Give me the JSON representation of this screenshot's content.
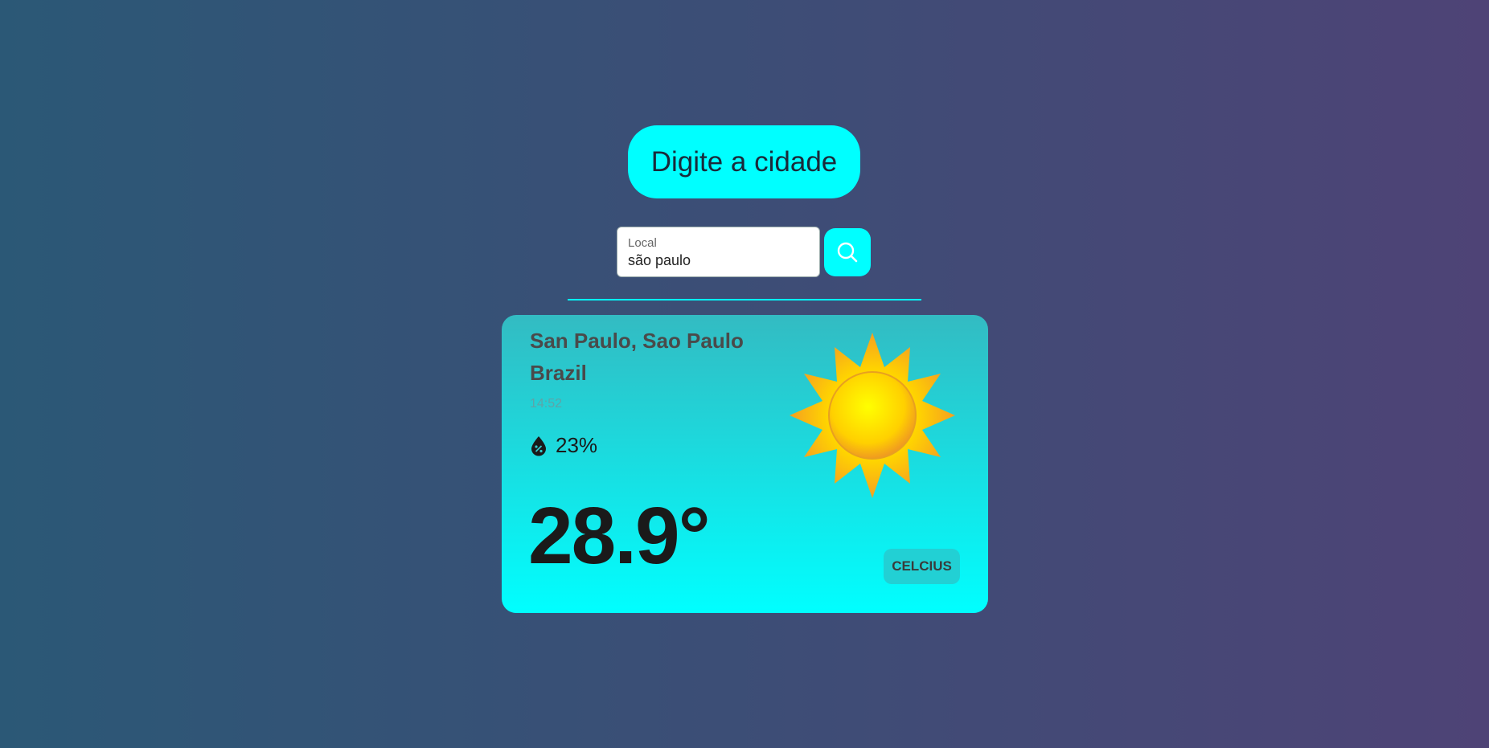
{
  "header": {
    "title": "Digite a cidade"
  },
  "search": {
    "label": "Local",
    "value": "são paulo",
    "button_icon": "search-icon"
  },
  "weather": {
    "city": "San Paulo, Sao Paulo",
    "country": "Brazil",
    "time": "14:52",
    "humidity": "23%",
    "humidity_icon": "humidity-drop-icon",
    "temperature": "28.9°",
    "condition_icon": "sun-icon",
    "unit_button": "CELCIUS"
  },
  "colors": {
    "accent": "#00ffff",
    "bg_start": "#2b5876",
    "bg_end": "#4e4376"
  }
}
